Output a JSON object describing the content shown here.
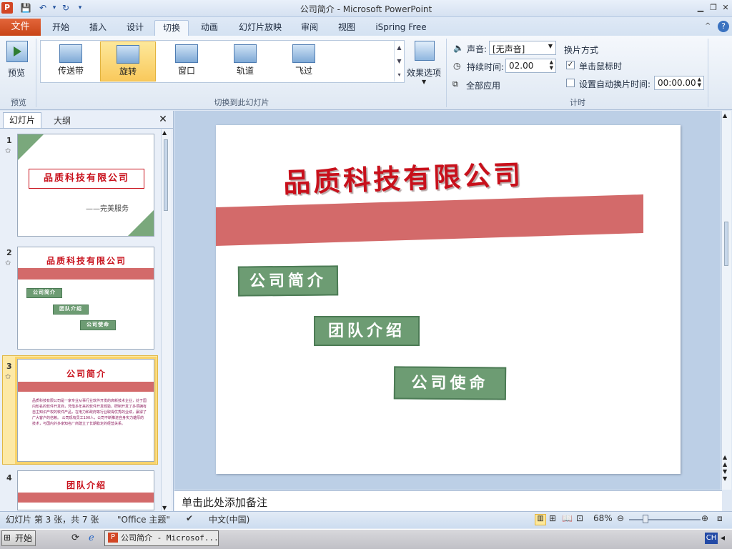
{
  "window": {
    "title": "公司简介 - Microsoft PowerPoint",
    "app_icon": "P",
    "qa_icons": [
      "save-icon",
      "undo-icon",
      "redo-icon",
      "customize-icon"
    ]
  },
  "tabs": {
    "file": "文件",
    "items": [
      "开始",
      "插入",
      "设计",
      "切换",
      "动画",
      "幻灯片放映",
      "审阅",
      "视图",
      "iSpring Free"
    ],
    "active": "切换"
  },
  "ribbon": {
    "preview_label": "预览",
    "preview_group": "预览",
    "transitions": [
      "传送带",
      "旋转",
      "窗口",
      "轨道",
      "飞过"
    ],
    "selected_transition": "旋转",
    "effect_options": "效果选项",
    "transition_group": "切换到此幻灯片",
    "sound_label": "声音:",
    "sound_value": "[无声音]",
    "duration_label": "持续时间:",
    "duration_value": "02.00",
    "apply_all": "全部应用",
    "advance_title": "换片方式",
    "on_click_label": "单击鼠标时",
    "on_click_checked": true,
    "auto_advance_label": "设置自动换片时间:",
    "auto_advance_checked": false,
    "auto_advance_value": "00:00.00",
    "timing_group": "计时"
  },
  "panel": {
    "tab_slides": "幻灯片",
    "tab_outline": "大纲",
    "close": "✕"
  },
  "thumbnails": [
    {
      "num": "1",
      "title": "品质科技有限公司",
      "sub": "——完美服务"
    },
    {
      "num": "2",
      "title": "品质科技有限公司",
      "boxes": [
        "公司简介",
        "团队介绍",
        "公司使命"
      ]
    },
    {
      "num": "3",
      "title": "公司简介",
      "body": "品质科技有限公司是一家专业从事行业软件开发的高新技术企业，处于国内知名的软件开发商，凭借多年来的软件开发经验，研制开发了多项拥有自主知识产权的软件产品，在电力和政府等行业取得优秀的业绩，赢得了广大客户的信赖。 公司现有员工100人，公司不断推进自身实力雄厚的技术，与国内外多家知名厂商建立了长期稳定的经营关系。"
    },
    {
      "num": "4",
      "title": "团队介绍"
    }
  ],
  "slide": {
    "title": "品质科技有限公司",
    "boxes": [
      "公司简介",
      "团队介绍",
      "公司使命"
    ]
  },
  "notes_placeholder": "单击此处添加备注",
  "status": {
    "slide_info": "幻灯片 第 3 张，共 7 张",
    "theme": "\"Office 主题\"",
    "language": "中文(中国)",
    "zoom": "68%",
    "zoom_fraction": 0.68
  },
  "taskbar": {
    "start": "开始",
    "item": "公司简介 - Microsof...",
    "lang": "CH"
  },
  "colors": {
    "accent_red": "#c8101b",
    "stripe": "#d36a6a",
    "box_green": "#6d9c73",
    "file_tab": "#d24625"
  }
}
